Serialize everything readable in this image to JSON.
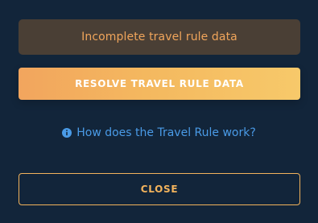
{
  "notice": {
    "text": "Incomplete travel rule data",
    "color": "#F0A55B"
  },
  "actions": {
    "resolve_label": "RESOLVE TRAVEL RULE DATA",
    "help_label": "How does the Travel Rule work?",
    "close_label": "CLOSE"
  },
  "icons": {
    "help": "info-icon"
  },
  "colors": {
    "background": "#12253A",
    "notice_background": "#4A3F35",
    "resolve_gradient_start": "#F2A55E",
    "resolve_gradient_end": "#F7C96A",
    "link": "#4A9BE7",
    "close_border": "#F2B35C"
  }
}
